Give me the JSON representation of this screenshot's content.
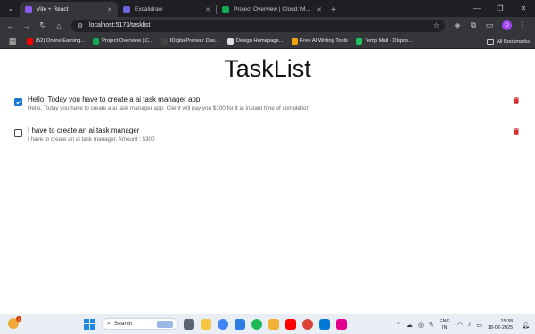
{
  "browser": {
    "tabs": [
      {
        "title": "Vite + React",
        "active": true,
        "favicon_color": "#8b5cf6"
      },
      {
        "title": "Excalidraw",
        "active": false,
        "favicon_color": "#6965db"
      },
      {
        "title": "Project Overview | Cloud: Mon...",
        "active": false,
        "favicon_color": "#13aa52"
      }
    ],
    "url": "localhost:5173/tasklist",
    "profile_initial": "D",
    "bookmarks": [
      {
        "label": "(52) Online Earning...",
        "color": "#ff0000"
      },
      {
        "label": "Project Overview | C...",
        "color": "#13aa52"
      },
      {
        "label": "IDigitalPreneur Das...",
        "color": "#444444"
      },
      {
        "label": "Design Homepage...",
        "color": "#dddddd"
      },
      {
        "label": "Free AI Writing Tools",
        "color": "#f59e0b"
      },
      {
        "label": "Temp Mail - Dispos...",
        "color": "#22c55e"
      }
    ],
    "all_bookmarks_label": "All Bookmarks"
  },
  "page": {
    "title": "TaskList",
    "tasks": [
      {
        "title": "Hello, Today you have to create a ai task manager app",
        "description": "Hello, Today you have to create a ai task manager app. Client will pay you $100 for it at instant time of completion",
        "completed": true
      },
      {
        "title": "I have to create an ai task manager",
        "description": "I have to create an ai task manager. Amount : $300",
        "completed": false
      }
    ],
    "colors": {
      "checkbox_checked": "#1976d2",
      "delete_icon": "#d32f2f"
    }
  },
  "taskbar": {
    "weather_badge": "1",
    "search_label": "Search",
    "apps": [
      {
        "name": "task-view-icon",
        "color": "#5a6472"
      },
      {
        "name": "file-explorer-icon",
        "color": "#f4c542"
      },
      {
        "name": "chrome-icon",
        "color": "#4285f4"
      },
      {
        "name": "photos-icon",
        "color": "#2d7be5"
      },
      {
        "name": "spotify-icon",
        "color": "#1db954"
      },
      {
        "name": "files-icon",
        "color": "#f2b035"
      },
      {
        "name": "youtube-icon",
        "color": "#ff0000"
      },
      {
        "name": "chrome-active-icon",
        "color": "#db4437"
      },
      {
        "name": "vscode-icon",
        "color": "#0078d4"
      },
      {
        "name": "snipping-tool-icon",
        "color": "#e3008c"
      }
    ],
    "lang_line1": "ENG",
    "lang_line2": "IN",
    "time": "15:38",
    "date": "18-02-2025"
  }
}
